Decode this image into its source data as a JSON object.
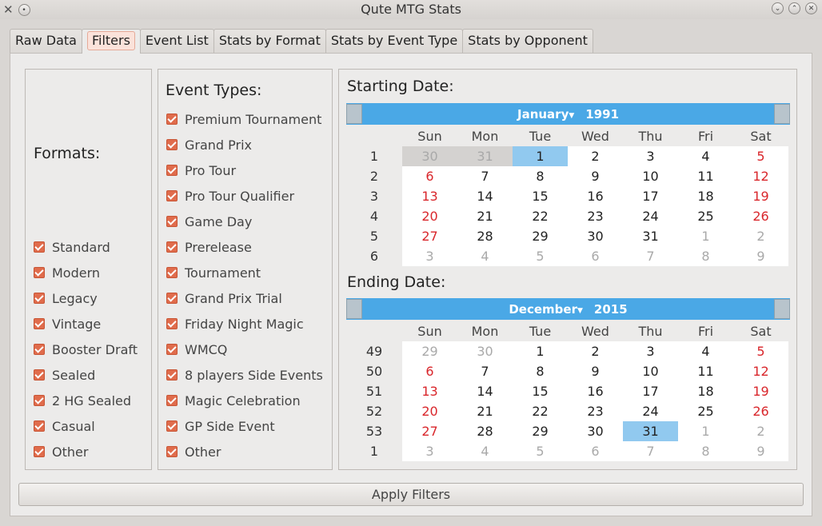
{
  "window": {
    "title": "Qute MTG Stats",
    "app_icon": "tools-icon"
  },
  "tabs": [
    {
      "label": "Raw Data"
    },
    {
      "label": "Filters",
      "active": true
    },
    {
      "label": "Event List"
    },
    {
      "label": "Stats by Format"
    },
    {
      "label": "Stats by Event Type"
    },
    {
      "label": "Stats by Opponent"
    }
  ],
  "formats": {
    "title": "Formats:",
    "items": [
      {
        "label": "Standard",
        "checked": true
      },
      {
        "label": "Modern",
        "checked": true
      },
      {
        "label": "Legacy",
        "checked": true
      },
      {
        "label": "Vintage",
        "checked": true
      },
      {
        "label": "Booster Draft",
        "checked": true
      },
      {
        "label": "Sealed",
        "checked": true
      },
      {
        "label": "2 HG Sealed",
        "checked": true
      },
      {
        "label": "Casual",
        "checked": true
      },
      {
        "label": "Other",
        "checked": true
      }
    ]
  },
  "event_types": {
    "title": "Event Types:",
    "items": [
      {
        "label": "Premium Tournament",
        "checked": true
      },
      {
        "label": "Grand Prix",
        "checked": true
      },
      {
        "label": "Pro Tour",
        "checked": true
      },
      {
        "label": "Pro Tour Qualifier",
        "checked": true
      },
      {
        "label": "Game Day",
        "checked": true
      },
      {
        "label": "Prerelease",
        "checked": true
      },
      {
        "label": "Tournament",
        "checked": true
      },
      {
        "label": "Grand Prix Trial",
        "checked": true
      },
      {
        "label": "Friday Night Magic",
        "checked": true
      },
      {
        "label": "WMCQ",
        "checked": true
      },
      {
        "label": "8 players Side Events",
        "checked": true
      },
      {
        "label": "Magic Celebration",
        "checked": true
      },
      {
        "label": "GP Side Event",
        "checked": true
      },
      {
        "label": "Other",
        "checked": true
      }
    ]
  },
  "starting_date": {
    "title": "Starting Date:",
    "month": "January",
    "year": "1991",
    "weekdays": [
      "Sun",
      "Mon",
      "Tue",
      "Wed",
      "Thu",
      "Fri",
      "Sat"
    ],
    "weeks": [
      {
        "num": "1",
        "days": [
          "30",
          "31",
          "1",
          "2",
          "3",
          "4",
          "5"
        ],
        "dim": [
          true,
          true,
          false,
          false,
          false,
          false,
          false
        ]
      },
      {
        "num": "2",
        "days": [
          "6",
          "7",
          "8",
          "9",
          "10",
          "11",
          "12"
        ],
        "dim": [
          false,
          false,
          false,
          false,
          false,
          false,
          false
        ]
      },
      {
        "num": "3",
        "days": [
          "13",
          "14",
          "15",
          "16",
          "17",
          "18",
          "19"
        ],
        "dim": [
          false,
          false,
          false,
          false,
          false,
          false,
          false
        ]
      },
      {
        "num": "4",
        "days": [
          "20",
          "21",
          "22",
          "23",
          "24",
          "25",
          "26"
        ],
        "dim": [
          false,
          false,
          false,
          false,
          false,
          false,
          false
        ]
      },
      {
        "num": "5",
        "days": [
          "27",
          "28",
          "29",
          "30",
          "31",
          "1",
          "2"
        ],
        "dim": [
          false,
          false,
          false,
          false,
          false,
          true,
          true
        ]
      },
      {
        "num": "6",
        "days": [
          "3",
          "4",
          "5",
          "6",
          "7",
          "8",
          "9"
        ],
        "dim": [
          true,
          true,
          true,
          true,
          true,
          true,
          true
        ]
      }
    ],
    "selected": {
      "week": 0,
      "day": 2
    },
    "greyed": [
      [
        0,
        0
      ],
      [
        0,
        1
      ]
    ]
  },
  "ending_date": {
    "title": "Ending Date:",
    "month": "December",
    "year": "2015",
    "weekdays": [
      "Sun",
      "Mon",
      "Tue",
      "Wed",
      "Thu",
      "Fri",
      "Sat"
    ],
    "weeks": [
      {
        "num": "49",
        "days": [
          "29",
          "30",
          "1",
          "2",
          "3",
          "4",
          "5"
        ],
        "dim": [
          true,
          true,
          false,
          false,
          false,
          false,
          false
        ]
      },
      {
        "num": "50",
        "days": [
          "6",
          "7",
          "8",
          "9",
          "10",
          "11",
          "12"
        ],
        "dim": [
          false,
          false,
          false,
          false,
          false,
          false,
          false
        ]
      },
      {
        "num": "51",
        "days": [
          "13",
          "14",
          "15",
          "16",
          "17",
          "18",
          "19"
        ],
        "dim": [
          false,
          false,
          false,
          false,
          false,
          false,
          false
        ]
      },
      {
        "num": "52",
        "days": [
          "20",
          "21",
          "22",
          "23",
          "24",
          "25",
          "26"
        ],
        "dim": [
          false,
          false,
          false,
          false,
          false,
          false,
          false
        ]
      },
      {
        "num": "53",
        "days": [
          "27",
          "28",
          "29",
          "30",
          "31",
          "1",
          "2"
        ],
        "dim": [
          false,
          false,
          false,
          false,
          false,
          true,
          true
        ]
      },
      {
        "num": "1",
        "days": [
          "3",
          "4",
          "5",
          "6",
          "7",
          "8",
          "9"
        ],
        "dim": [
          true,
          true,
          true,
          true,
          true,
          true,
          true
        ]
      }
    ],
    "selected": {
      "week": 4,
      "day": 4
    },
    "greyed": []
  },
  "apply_button": {
    "label": "Apply Filters"
  },
  "colors": {
    "accent_checkbox": "#e06c4c",
    "calendar_header": "#4aa8e6",
    "selected_day": "#91c9ef",
    "weekend_text": "#d9262b"
  }
}
